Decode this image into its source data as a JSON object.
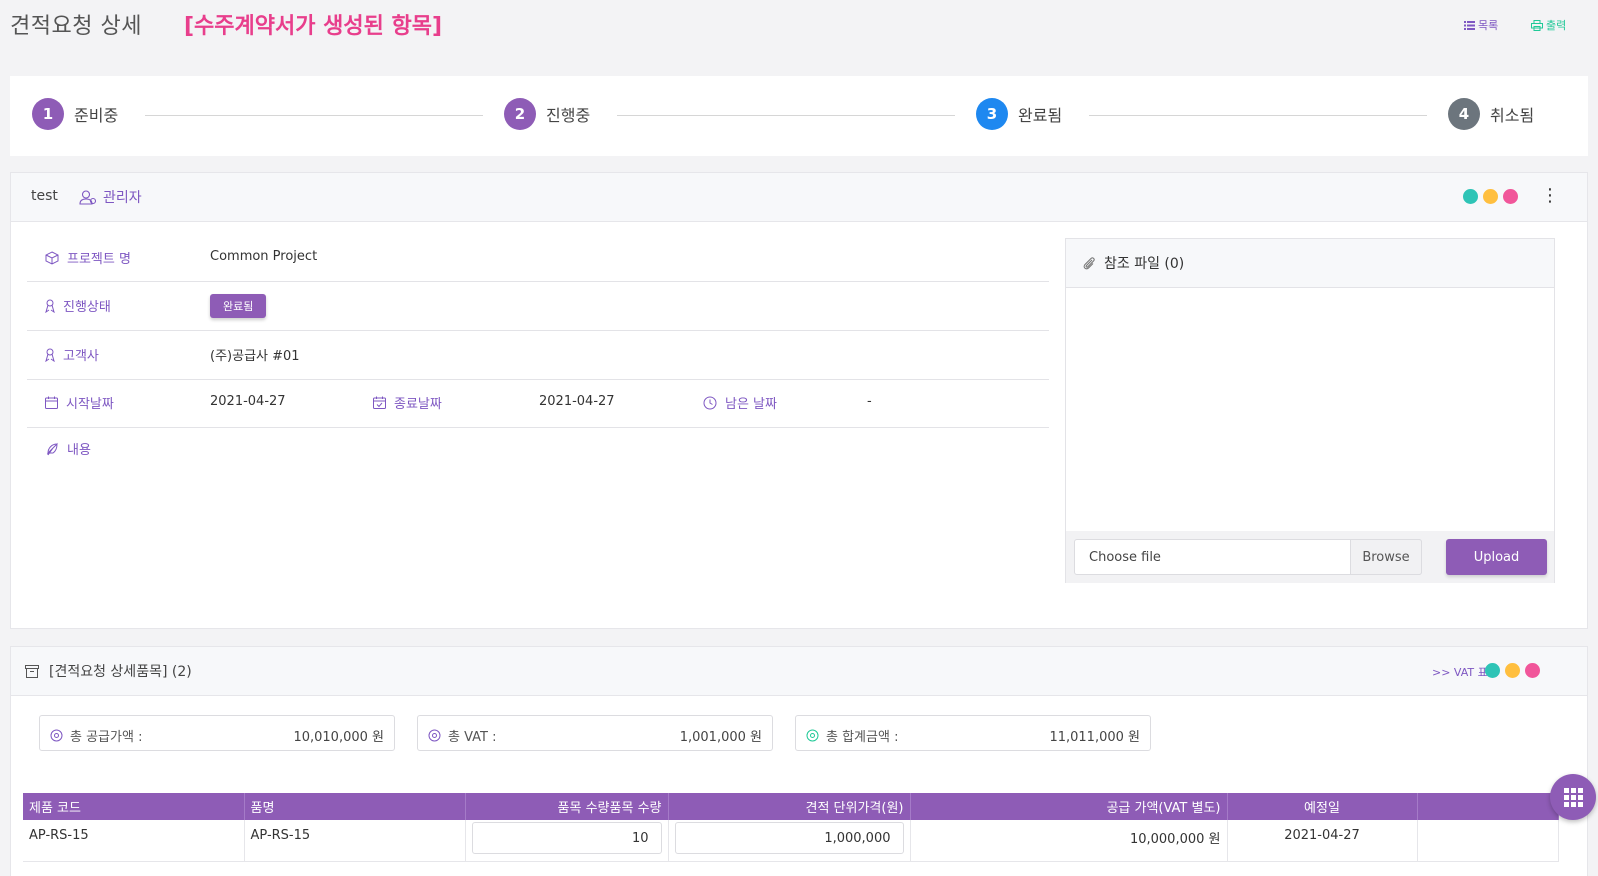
{
  "header": {
    "title": "견적요청 상세",
    "subtitle": "[수주계약서가 생성된 항목]",
    "list_link": "목록",
    "print_link": "출력"
  },
  "steps": [
    {
      "num": "1",
      "label": "준비중",
      "color": "#8e5cb6"
    },
    {
      "num": "2",
      "label": "진행중",
      "color": "#8e5cb6"
    },
    {
      "num": "3",
      "label": "완료됨",
      "color": "#1e88f0"
    },
    {
      "num": "4",
      "label": "취소됨",
      "color": "#6c757d"
    }
  ],
  "detail": {
    "owner": "test",
    "role": "관리자",
    "dot_colors": [
      "#2ec4b6",
      "#ffbf3f",
      "#f1569a"
    ],
    "project_label": "프로젝트 명",
    "project_value": "Common Project",
    "status_label": "진행상태",
    "status_value": "완료됨",
    "client_label": "고객사",
    "client_value": "(주)공급사 #01",
    "start_label": "시작날짜",
    "start_value": "2021-04-27",
    "end_label": "종료날짜",
    "end_value": "2021-04-27",
    "remain_label": "남은 날짜",
    "remain_value": "-",
    "content_label": "내용"
  },
  "files": {
    "title": "참조 파일 (0)",
    "placeholder": "Choose file",
    "browse": "Browse",
    "upload": "Upload"
  },
  "items": {
    "title": "[견적요청 상세품목] (2)",
    "vat_toggle": ">> VAT 표시",
    "sum_supply_label": "총 공급가액 :",
    "sum_supply_value": "10,010,000 원",
    "sum_vat_label": "총 VAT :",
    "sum_vat_value": "1,001,000 원",
    "sum_total_label": "총 합계금액 :",
    "sum_total_value": "11,011,000 원",
    "columns": [
      "제품 코드",
      "품명",
      "품목 수량품목 수량",
      "견적 단위가격(원)",
      "공급 가액(VAT 별도)",
      "예정일",
      ""
    ],
    "rows": [
      {
        "code": "AP-RS-15",
        "name": "AP-RS-15",
        "qty": "10",
        "unit_price": "1,000,000",
        "supply": "10,000,000 원",
        "date": "2021-04-27"
      }
    ]
  }
}
